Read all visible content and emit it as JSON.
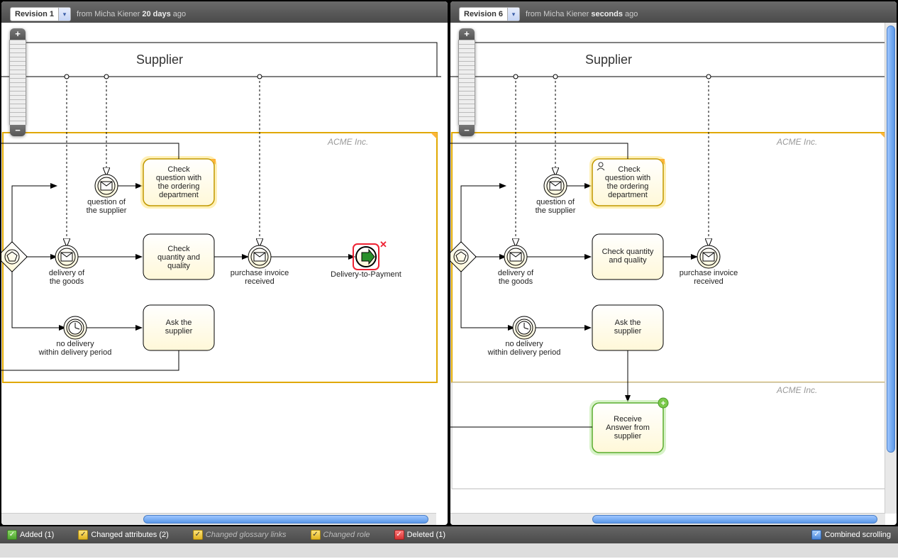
{
  "left": {
    "revision_label": "Revision 1",
    "meta_prefix": "from Micha Kiener ",
    "meta_strong": "20 days",
    "meta_suffix": " ago",
    "pool": "Supplier",
    "lane": "ACME Inc.",
    "tasks": {
      "check_question": "Check question with the ordering department",
      "check_qty": "Check quantity and quality",
      "ask_supplier": "Ask the supplier"
    },
    "events": {
      "q_supplier1": "question of",
      "q_supplier2": "the supplier",
      "delivery1": "delivery of",
      "delivery2": "the goods",
      "inv1": "purchase invoice",
      "inv2": "received",
      "nodeliv1": "no delivery",
      "nodeliv2": "within delivery period",
      "delpay": "Delivery-to-Payment"
    }
  },
  "right": {
    "revision_label": "Revision 6",
    "meta_prefix": "from Micha Kiener ",
    "meta_strong": "seconds",
    "meta_suffix": " ago",
    "pool": "Supplier",
    "lane": "ACME Inc.",
    "lane2": "ACME Inc.",
    "tasks": {
      "check_question": "Check question with the ordering department",
      "check_qty": "Check quantity and quality",
      "ask_supplier": "Ask the supplier",
      "receive_ans": "Receive Answer from supplier"
    },
    "events": {
      "q_supplier1": "question of",
      "q_supplier2": "the supplier",
      "delivery1": "delivery of",
      "delivery2": "the goods",
      "inv1": "purchase invoice",
      "inv2": "received",
      "nodeliv1": "no delivery",
      "nodeliv2": "within delivery period"
    }
  },
  "status": {
    "added": "Added (1)",
    "changed_attr": "Changed attributes (2)",
    "changed_gloss": "Changed glossary links",
    "changed_role": "Changed role",
    "deleted": "Deleted (1)",
    "combined": "Combined scrolling"
  }
}
